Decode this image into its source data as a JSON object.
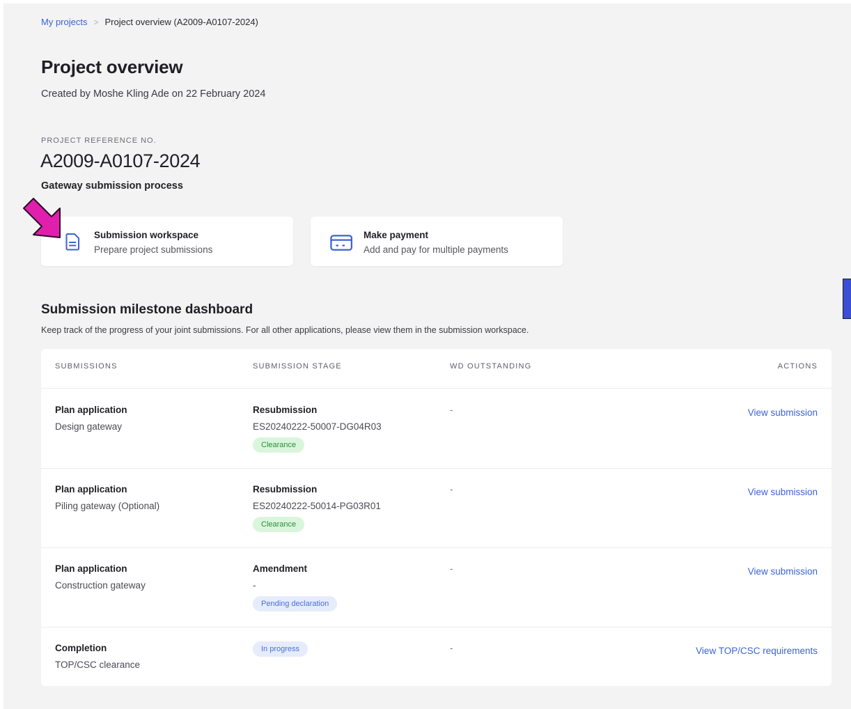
{
  "breadcrumb": {
    "parent": "My projects",
    "separator": ">",
    "current": "Project overview (A2009-A0107-2024)"
  },
  "header": {
    "title": "Project overview",
    "created_by": "Created by Moshe Kling Ade on 22 February 2024"
  },
  "project": {
    "reference_label": "PROJECT REFERENCE NO.",
    "reference_value": "A2009-A0107-2024",
    "process_label": "Gateway submission process"
  },
  "cards": [
    {
      "title": "Submission workspace",
      "description": "Prepare project submissions",
      "icon": "document-icon"
    },
    {
      "title": "Make payment",
      "description": "Add and pay for multiple payments",
      "icon": "credit-card-icon"
    }
  ],
  "annotation": {
    "icon": "pointer-arrow-icon",
    "color": "#e01fae"
  },
  "dashboard": {
    "title": "Submission milestone dashboard",
    "description": "Keep track of the progress of your joint submissions. For all other applications, please view them in the submission workspace.",
    "columns": [
      "SUBMISSIONS",
      "SUBMISSION STAGE",
      "WD OUTSTANDING",
      "ACTIONS"
    ],
    "rows": [
      {
        "submission_title": "Plan application",
        "submission_sub": "Design gateway",
        "stage_title": "Resubmission",
        "stage_ref": "ES20240222-50007-DG04R03",
        "status": "Clearance",
        "wd": "-",
        "action": "View submission"
      },
      {
        "submission_title": "Plan application",
        "submission_sub": "Piling gateway (Optional)",
        "stage_title": "Resubmission",
        "stage_ref": "ES20240222-50014-PG03R01",
        "status": "Clearance",
        "wd": "-",
        "action": "View submission"
      },
      {
        "submission_title": "Plan application",
        "submission_sub": "Construction gateway",
        "stage_title": "Amendment",
        "stage_ref": "-",
        "status": "Pending declaration",
        "wd": "-",
        "action": "View submission"
      },
      {
        "submission_title": "Completion",
        "submission_sub": "TOP/CSC clearance",
        "status": "In progress",
        "wd": "-",
        "action": "View TOP/CSC requirements"
      }
    ]
  },
  "colors": {
    "accent": "#3b63d6",
    "badge_green_bg": "#d9f6dc",
    "badge_green_text": "#2f8a3b",
    "badge_blue_bg": "#e6ecfb",
    "badge_blue_text": "#4a6fd8",
    "page_bg": "#f3f3f4"
  }
}
